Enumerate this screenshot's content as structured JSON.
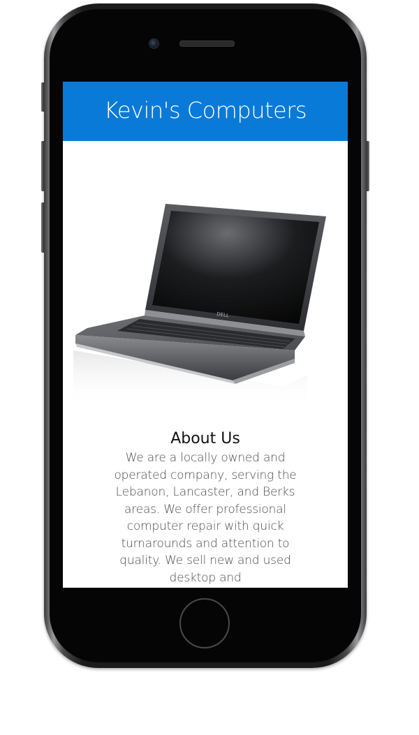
{
  "app": {
    "site_title": "Kevin's Computers",
    "header_color": "#0a7ad9"
  },
  "hero": {
    "image_icon": "laptop-image",
    "brand_mark": "DELL"
  },
  "about": {
    "heading": "About Us",
    "body": "We are a locally owned and operated company, serving the Lebanon, Lancaster, and Berks areas. We offer professional computer repair with quick turnarounds and attention to quality. We sell new and used desktop and"
  },
  "device": {
    "frame_icon": "phone-frame",
    "home_icon": "home-button-icon",
    "camera_icon": "camera-icon",
    "speaker_icon": "speaker-icon"
  }
}
